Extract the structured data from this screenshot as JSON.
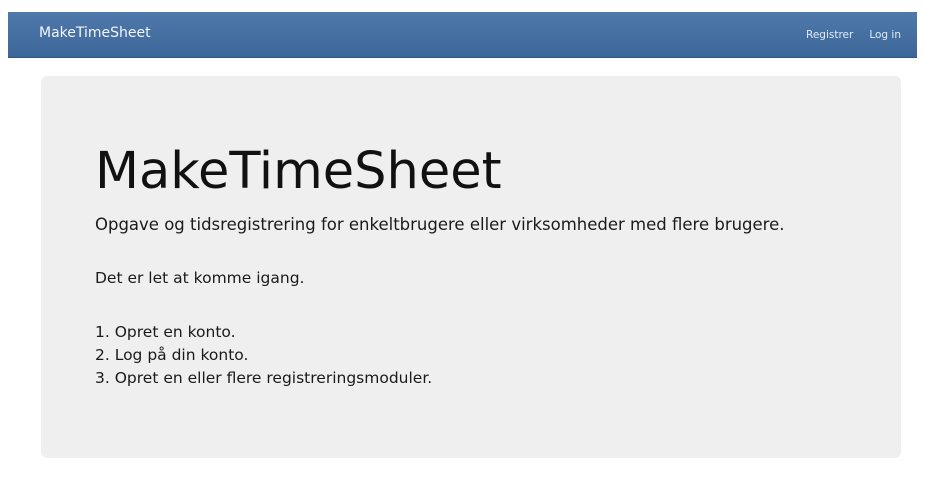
{
  "navbar": {
    "brand": "MakeTimeSheet",
    "links": [
      "Registrer",
      "Log in"
    ]
  },
  "hero": {
    "title": "MakeTimeSheet",
    "subtitle": "Opgave og tidsregistrering for enkeltbrugere eller virksomheder med flere brugere.",
    "intro": "Det er let at komme igang.",
    "steps": [
      "1. Opret en konto.",
      "2. Log på din konto.",
      "3. Opret en eller flere registreringsmoduler."
    ]
  }
}
